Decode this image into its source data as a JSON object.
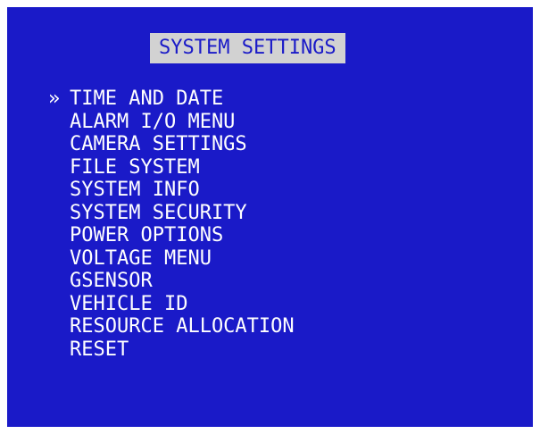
{
  "screen": {
    "title": "SYSTEM SETTINGS",
    "selection_marker": "»",
    "selected_index": 0,
    "background_color": "#1a1ac8",
    "title_background_color": "#d2d2d2",
    "text_color": "#ffffff",
    "menu_items": [
      "TIME AND DATE",
      "ALARM I/O MENU",
      "CAMERA SETTINGS",
      "FILE SYSTEM",
      "SYSTEM INFO",
      "SYSTEM SECURITY",
      "POWER OPTIONS",
      "VOLTAGE MENU",
      "GSENSOR",
      "VEHICLE ID",
      "RESOURCE ALLOCATION",
      "RESET"
    ]
  }
}
